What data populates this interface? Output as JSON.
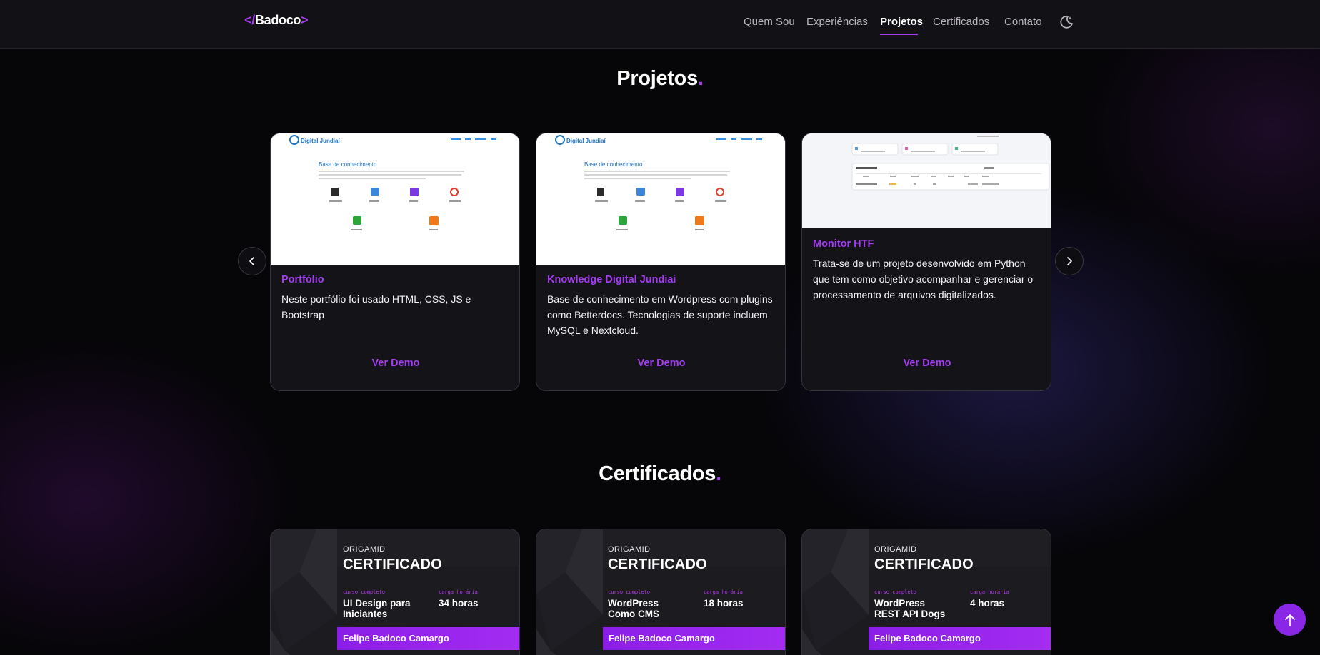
{
  "header": {
    "logo_open": "</",
    "logo_text": "Badoco",
    "logo_close": ">",
    "nav": [
      {
        "label": "Quem Sou"
      },
      {
        "label": "Experiências"
      },
      {
        "label": "Projetos"
      },
      {
        "label": "Certificados"
      },
      {
        "label": "Contato"
      }
    ],
    "active_nav": "Projetos",
    "theme_toggle_icon": "moon-icon"
  },
  "projects": {
    "title": "Projetos",
    "title_dot": ".",
    "prev_icon": "chevron-left-icon",
    "next_icon": "chevron-right-icon",
    "cards": [
      {
        "title": "Portfólio",
        "description": "Neste portfólio foi usado HTML, CSS, JS e Bootstrap",
        "link": "Ver Demo"
      },
      {
        "title": "Knowledge Digital Jundiai",
        "description": "Base de conhecimento em Wordpress com plugins como Betterdocs. Tecnologias de suporte incluem MySQL e Nextcloud.",
        "link": "Ver Demo"
      },
      {
        "title": "Monitor HTF",
        "description": "Trata-se de um projeto desenvolvido em Python que tem como objetivo acompanhar e gerenciar o processamento de arquivos digitalizados.",
        "link": "Ver Demo"
      }
    ],
    "thumb_kb": {
      "brand": "Digital Jundiaí",
      "heading": "Base de conhecimento"
    }
  },
  "certificates": {
    "title": "Certificados",
    "title_dot": ".",
    "items": [
      {
        "brand": "ORIGAMID",
        "heading": "CERTIFICADO",
        "course_label": "curso completo",
        "course": "UI Design para Iniciantes",
        "hours_label": "carga horária",
        "hours": "34 horas",
        "name": "Felipe Badoco Camargo"
      },
      {
        "brand": "ORIGAMID",
        "heading": "CERTIFICADO",
        "course_label": "curso completo",
        "course": "WordPress Como CMS",
        "hours_label": "carga horária",
        "hours": "18 horas",
        "name": "Felipe Badoco Camargo"
      },
      {
        "brand": "ORIGAMID",
        "heading": "CERTIFICADO",
        "course_label": "curso completo",
        "course": "WordPress REST API Dogs",
        "hours_label": "carga horária",
        "hours": "4 horas",
        "name": "Felipe Badoco Camargo"
      }
    ]
  },
  "back_to_top_icon": "arrow-up-icon",
  "colors": {
    "accent": "#a43cf0",
    "background": "#060508",
    "header_bg": "#121115",
    "card_bg": "#141318"
  }
}
